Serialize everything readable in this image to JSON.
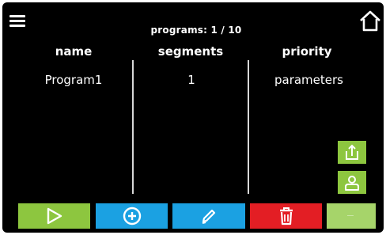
{
  "header": {
    "programs_count": "programs: 1 / 10"
  },
  "columns": {
    "name": "name",
    "segments": "segments",
    "priority": "priority"
  },
  "program_row": {
    "name": "Program1",
    "segments": "1",
    "priority": "parameters"
  },
  "icons": {
    "menu": "hamburger-menu-icon",
    "home": "home-icon",
    "export": "export-icon",
    "user": "user-icon",
    "play": "play-icon",
    "add": "add-icon",
    "edit": "pencil-icon",
    "delete": "trash-icon"
  },
  "colors": {
    "green": "#8dc63f",
    "blue": "#1ba1e2",
    "red": "#e31e24",
    "background": "#000000"
  }
}
